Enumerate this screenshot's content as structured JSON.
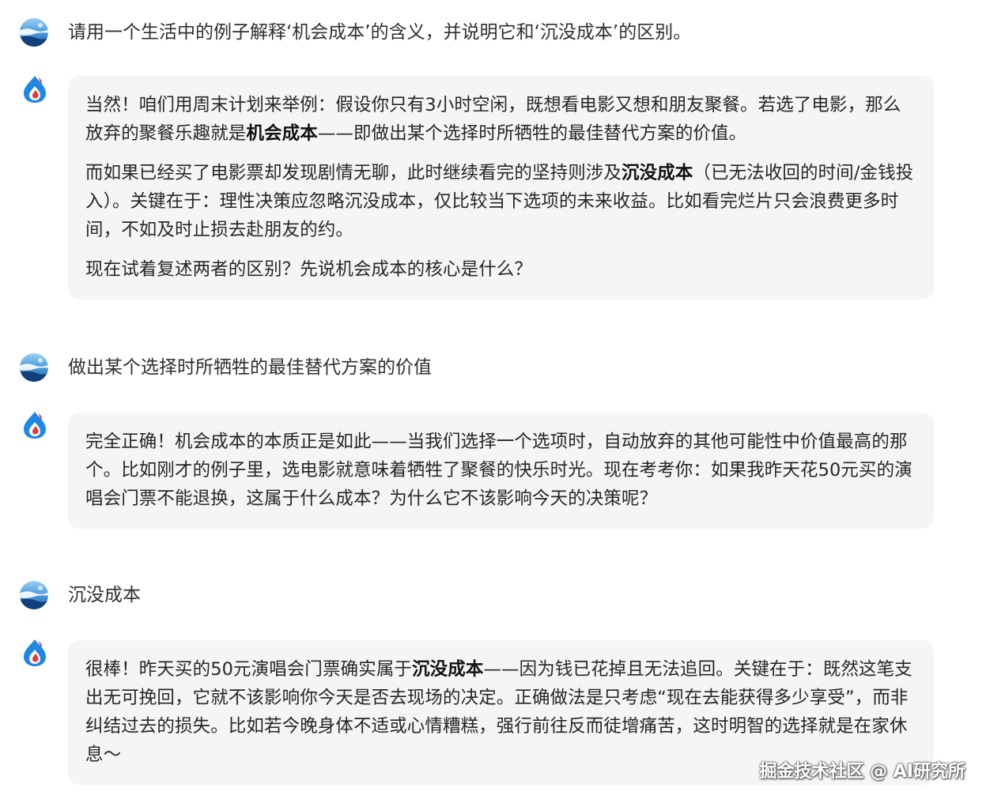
{
  "colors": {
    "bubble_background": "#f5f5f7",
    "user_avatar": "#2f7fd0",
    "ai_avatar_blue": "#1e88e5",
    "ai_avatar_red": "#e53935"
  },
  "icons": {
    "user_avatar": "earth-landscape-avatar-icon",
    "ai_avatar": "flame-drop-logo-icon"
  },
  "conversation": {
    "q1": "请用一个生活中的例子解释‘机会成本’的含义，并说明它和‘沉没成本’的区别。",
    "a1": {
      "p1_before": "当然！咱们用周末计划来举例：假设你只有3小时空闲，既想看电影又想和朋友聚餐。若选了电影，那么放弃的聚餐乐趣就是",
      "p1_bold": "机会成本",
      "p1_after": "——即做出某个选择时所牺牲的最佳替代方案的价值。",
      "p2_before": "而如果已经买了电影票却发现剧情无聊，此时继续看完的坚持则涉及",
      "p2_bold": "沉没成本",
      "p2_after": "（已无法收回的时间/金钱投入）。关键在于：理性决策应忽略沉没成本，仅比较当下选项的未来收益。比如看完烂片只会浪费更多时间，不如及时止损去赴朋友的约。",
      "p3": "现在试着复述两者的区别？先说机会成本的核心是什么？"
    },
    "q2": "做出某个选择时所牺牲的最佳替代方案的价值",
    "a2": {
      "p1": "完全正确！机会成本的本质正是如此——当我们选择一个选项时，自动放弃的其他可能性中价值最高的那个。比如刚才的例子里，选电影就意味着牺牲了聚餐的快乐时光。现在考考你：如果我昨天花50元买的演唱会门票不能退换，这属于什么成本？为什么它不该影响今天的决策呢？"
    },
    "q3": "沉没成本",
    "a3": {
      "p1_before": "很棒！昨天买的50元演唱会门票确实属于",
      "p1_bold": "沉没成本",
      "p1_after": "——因为钱已花掉且无法追回。关键在于：既然这笔支出无可挽回，它就不该影响你今天是否去现场的决定。正确做法是只考虑“现在去能获得多少享受”，而非纠结过去的损失。比如若今晚身体不适或心情糟糕，强行前往反而徒增痛苦，这时明智的选择就是在家休息～"
    }
  },
  "watermark": "掘金技术社区 @ AI研究所"
}
